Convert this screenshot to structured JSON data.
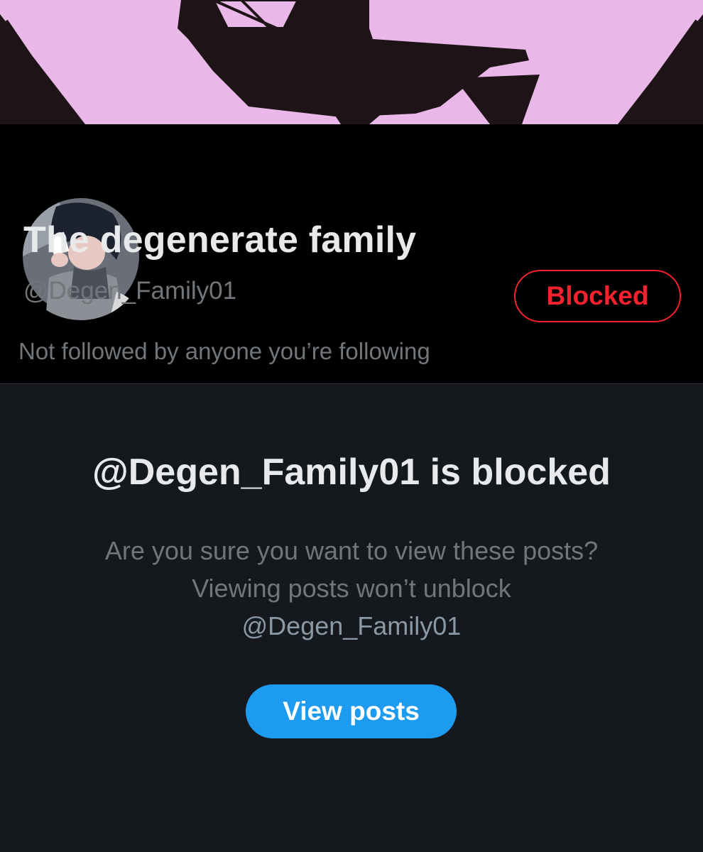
{
  "profile": {
    "display_name": "The degenerate family",
    "handle": "@Degen_Family01",
    "followers_note": "Not followed by anyone you’re following",
    "blocked_button_label": "Blocked"
  },
  "blocked_notice": {
    "title": "@Degen_Family01 is blocked",
    "message_line1": "Are you sure you want to view these posts? Viewing posts won’t unblock",
    "message_handle": "@Degen_Family01",
    "view_posts_label": "View posts"
  },
  "colors": {
    "banner_pink": "#e9b8e8",
    "banner_dark": "#1e1417",
    "blocked_red": "#f4212e",
    "accent_blue": "#1d9bf0",
    "profile_bg": "#000000",
    "panel_bg": "#15181c"
  }
}
